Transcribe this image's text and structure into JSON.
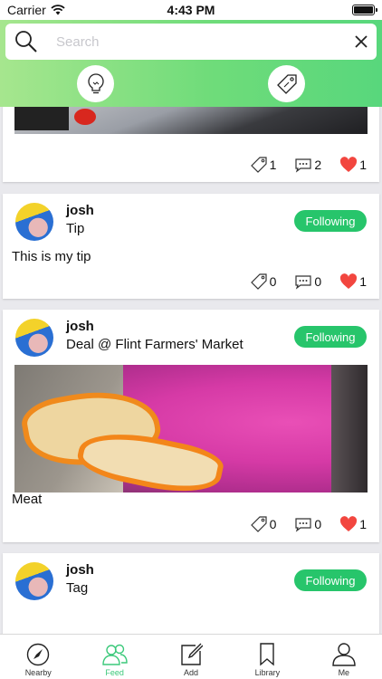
{
  "status": {
    "carrier": "Carrier",
    "time": "4:43 PM"
  },
  "search": {
    "placeholder": "Search",
    "value": ""
  },
  "header": {
    "tips_icon": "lightbulb-icon",
    "deals_icon": "price-tag-icon"
  },
  "posts": [
    {
      "likes_text": "1",
      "tags": "1",
      "comments": "2",
      "likes": "1"
    },
    {
      "username": "josh",
      "subtitle": "Tip",
      "follow_label": "Following",
      "text": "This is my tip",
      "tags": "0",
      "comments": "0",
      "likes": "1"
    },
    {
      "username": "josh",
      "subtitle": "Deal @ Flint Farmers' Market",
      "follow_label": "Following",
      "text": "Meat",
      "tags": "0",
      "comments": "0",
      "likes": "1"
    },
    {
      "username": "josh",
      "subtitle": "Tag",
      "follow_label": "Following"
    }
  ],
  "colors": {
    "accent": "#27c56b",
    "heart": "#f2463f",
    "header_gradient_start": "#a6e68e",
    "header_gradient_end": "#58d77c"
  },
  "tabs": [
    {
      "label": "Nearby",
      "icon": "navigation-arrow-icon"
    },
    {
      "label": "Feed",
      "icon": "people-icon",
      "active": true
    },
    {
      "label": "Add",
      "icon": "compose-icon"
    },
    {
      "label": "Library",
      "icon": "bookmark-icon"
    },
    {
      "label": "Me",
      "icon": "person-icon"
    }
  ]
}
